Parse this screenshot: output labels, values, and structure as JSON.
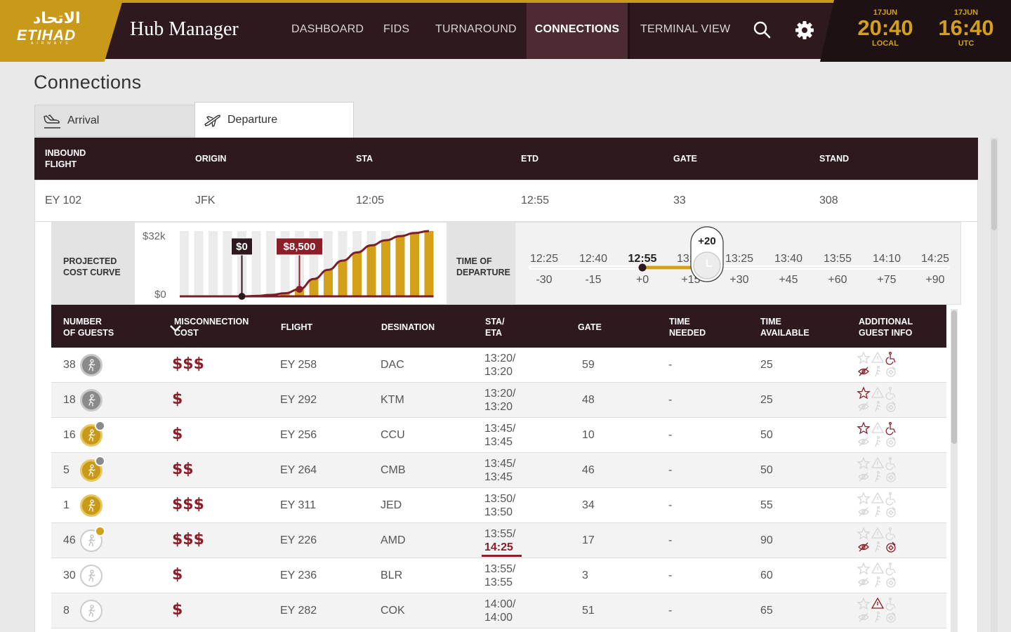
{
  "brand": {
    "logo_ar": "الاتحاد",
    "logo_en": "ETIHAD",
    "logo_sub": "AIRWAYS"
  },
  "app_title": "Hub Manager",
  "nav": {
    "dashboard": "DASHBOARD",
    "fids": "FIDS",
    "turnaround": "TURNAROUND",
    "connections": "CONNECTIONS",
    "terminal_view": "TERMINAL VIEW"
  },
  "clocks": {
    "local": {
      "date": "17JUN",
      "time": "20:40",
      "zone": "LOCAL"
    },
    "utc": {
      "date": "17JUN",
      "time": "16:40",
      "zone": "UTC"
    }
  },
  "page_title": "Connections",
  "tabs": {
    "arrival": "Arrival",
    "departure": "Departure"
  },
  "inbound": {
    "headers": {
      "flight_1": "INBOUND",
      "flight_2": "FLIGHT",
      "origin": "ORIGIN",
      "sta": "STA",
      "etd": "ETD",
      "gate": "GATE",
      "stand": "STAND"
    },
    "row": {
      "flight": "EY 102",
      "origin": "JFK",
      "sta": "12:05",
      "etd": "12:55",
      "gate": "33",
      "stand": "308"
    }
  },
  "projected": {
    "label_1": "PROJECTED",
    "label_2": "COST CURVE"
  },
  "chart_data": {
    "type": "bar",
    "y_ticks": [
      "$32k",
      "$0"
    ],
    "ylim": [
      0,
      32000
    ],
    "values": [
      0,
      0,
      0,
      0,
      0,
      200,
      700,
      1500,
      3500,
      8500,
      13000,
      17500,
      21500,
      25000,
      27500,
      29500,
      31000,
      32000
    ],
    "markers": [
      {
        "label": "$0",
        "bar_index": 4,
        "value": 0
      },
      {
        "label": "$8,500",
        "bar_index": 8,
        "value": 8500
      }
    ],
    "bar_color": "#d4a019",
    "curve_color": "#7a1f2a"
  },
  "tod": {
    "label_1": "TIME OF",
    "label_2": "DEPARTURE"
  },
  "timeline": {
    "times": [
      "12:25",
      "12:40",
      "12:55",
      "13:10",
      "13:25",
      "13:40",
      "13:55",
      "14:10",
      "14:25"
    ],
    "offsets": [
      "-30",
      "-15",
      "+0",
      "+15",
      "+30",
      "+45",
      "+60",
      "+75",
      "+90"
    ],
    "selected_offset": "+20",
    "current_index": 2
  },
  "connections": {
    "headers": {
      "guests_1": "NUMBER",
      "guests_2": "OF GUESTS",
      "cost_1": "MISCONNECTION",
      "cost_2": "COST",
      "flight": "FLIGHT",
      "dest": "DESINATION",
      "sta_1": "STA/",
      "sta_2": "ETA",
      "gate": "GATE",
      "need_1": "TIME",
      "need_2": "NEEDED",
      "avail_1": "TIME",
      "avail_2": "AVAILABLE",
      "info_1": "ADDITIONAL",
      "info_2": "GUEST INFO"
    },
    "rows": [
      {
        "guests": "38",
        "icon": "grey",
        "dot": "",
        "cost": "$$$",
        "flight": "EY 258",
        "dest": "DAC",
        "sta": "13:20/",
        "eta": "13:20",
        "delayed": false,
        "gate": "59",
        "need": "-",
        "avail": "25",
        "info": {
          "star": 0,
          "warn": 0,
          "wheel": 1,
          "eye": 1,
          "walk": 0,
          "cash": 0
        }
      },
      {
        "guests": "18",
        "icon": "grey",
        "dot": "",
        "cost": "$",
        "flight": "EY 292",
        "dest": "KTM",
        "sta": "13:20/",
        "eta": "13:20",
        "delayed": false,
        "gate": "48",
        "need": "-",
        "avail": "25",
        "info": {
          "star": 1,
          "warn": 0,
          "wheel": 0,
          "eye": 0,
          "walk": 0,
          "cash": 0
        }
      },
      {
        "guests": "16",
        "icon": "gold",
        "dot": "grey",
        "cost": "$",
        "flight": "EY 256",
        "dest": "CCU",
        "sta": "13:45/",
        "eta": "13:45",
        "delayed": false,
        "gate": "10",
        "need": "-",
        "avail": "50",
        "info": {
          "star": 1,
          "warn": 0,
          "wheel": 1,
          "eye": 0,
          "walk": 0,
          "cash": 0
        }
      },
      {
        "guests": "5",
        "icon": "gold",
        "dot": "grey",
        "cost": "$$",
        "flight": "EY 264",
        "dest": "CMB",
        "sta": "13:45/",
        "eta": "13:45",
        "delayed": false,
        "gate": "46",
        "need": "-",
        "avail": "50",
        "info": {
          "star": 0,
          "warn": 0,
          "wheel": 0,
          "eye": 0,
          "walk": 0,
          "cash": 0
        }
      },
      {
        "guests": "1",
        "icon": "gold",
        "dot": "",
        "cost": "$$$",
        "flight": "EY 311",
        "dest": "JED",
        "sta": "13:50/",
        "eta": "13:50",
        "delayed": false,
        "gate": "34",
        "need": "-",
        "avail": "55",
        "info": {
          "star": 0,
          "warn": 0,
          "wheel": 0,
          "eye": 0,
          "walk": 0,
          "cash": 0
        }
      },
      {
        "guests": "46",
        "icon": "white",
        "dot": "gold",
        "cost": "$$$",
        "flight": "EY 226",
        "dest": "AMD",
        "sta": "13:55/",
        "eta": "14:25",
        "delayed": true,
        "gate": "17",
        "need": "-",
        "avail": "90",
        "info": {
          "star": 0,
          "warn": 0,
          "wheel": 0,
          "eye": 1,
          "walk": 0,
          "cash": 1
        }
      },
      {
        "guests": "30",
        "icon": "white",
        "dot": "",
        "cost": "$",
        "flight": "EY 236",
        "dest": "BLR",
        "sta": "13:55/",
        "eta": "13:55",
        "delayed": false,
        "gate": "3",
        "need": "-",
        "avail": "60",
        "info": {
          "star": 0,
          "warn": 0,
          "wheel": 0,
          "eye": 0,
          "walk": 0,
          "cash": 0
        }
      },
      {
        "guests": "8",
        "icon": "white",
        "dot": "",
        "cost": "$",
        "flight": "EY 282",
        "dest": "COK",
        "sta": "14:00/",
        "eta": "14:00",
        "delayed": false,
        "gate": "51",
        "need": "-",
        "avail": "65",
        "info": {
          "star": 0,
          "warn": 1,
          "wheel": 0,
          "eye": 0,
          "walk": 0,
          "cash": 0
        }
      }
    ]
  },
  "colors": {
    "header_dark": "#2e1a1e",
    "gold": "#c99a19",
    "maroon": "#8a1f2a",
    "active_nav": "#4c2b33"
  }
}
